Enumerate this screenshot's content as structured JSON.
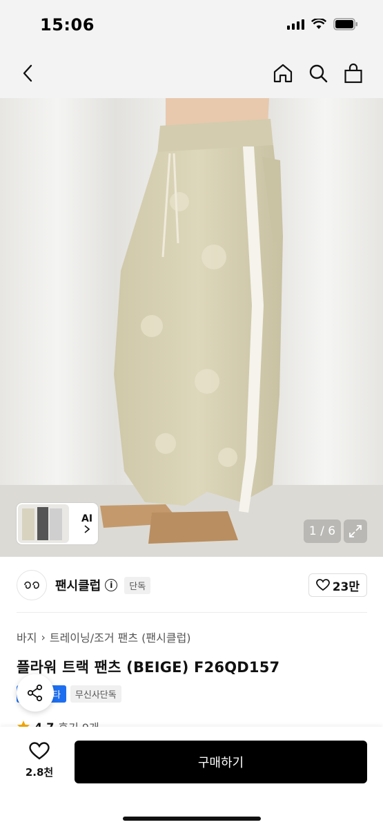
{
  "status": {
    "time": "15:06"
  },
  "gallery": {
    "pager": "1 / 6",
    "ai_label": "AI"
  },
  "brand": {
    "name": "팬시클럽",
    "badge": "단독",
    "likes": "23만"
  },
  "product": {
    "breadcrumb": [
      "바지",
      "트레이닝/조거 팬츠 (팬시클럽)"
    ],
    "title": "플라워 트랙 팬츠 (BEIGE) F26QD157",
    "tags": [
      "스타",
      "무신사단독"
    ],
    "rating": "4.7",
    "reviews": "후기 9개"
  },
  "bottom": {
    "wish_count": "2.8천",
    "buy_label": "구매하기"
  },
  "colors": {
    "buy_button": "#000000",
    "tag_blue": "#1e6ff0",
    "star": "#f2a900"
  }
}
